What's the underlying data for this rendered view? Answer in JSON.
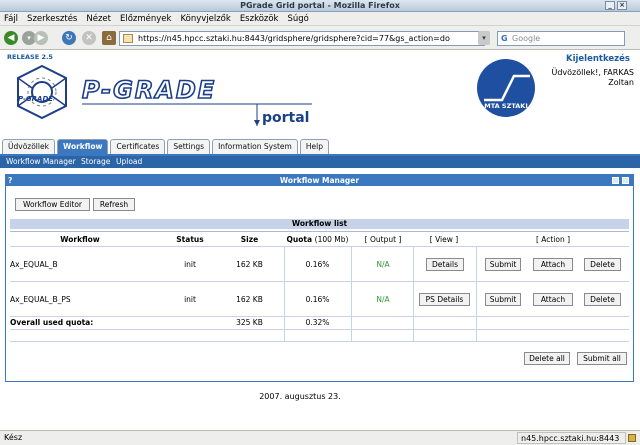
{
  "window": {
    "title": "PGrade Grid portal - Mozilla Firefox"
  },
  "menu": [
    "Fájl",
    "Szerkesztés",
    "Nézet",
    "Előzmények",
    "Könyvjelzők",
    "Eszközök",
    "Súgó"
  ],
  "nav": {
    "url": "https://n45.hpcc.sztaki.hu:8443/gridsphere/gridsphere?cid=77&gs_action=do",
    "search_placeholder": "Google"
  },
  "header": {
    "release": "RELEASE 2.5",
    "logo_small": "P-GRADE",
    "logo_big": "P-GRADE",
    "logo_portal": "portal",
    "mta_label": "MTA SZTAKI",
    "login_link": "Kijelentkezés",
    "welcome_line1": "Üdvözöllek!, FARKAS",
    "welcome_line2": "Zoltan"
  },
  "tabs": [
    {
      "label": "Üdvözöllek",
      "active": false
    },
    {
      "label": "Workflow",
      "active": true
    },
    {
      "label": "Certificates",
      "active": false
    },
    {
      "label": "Settings",
      "active": false
    },
    {
      "label": "Information System",
      "active": false
    },
    {
      "label": "Help",
      "active": false
    }
  ],
  "subnav": [
    "Workflow Manager",
    "Storage",
    "Upload"
  ],
  "portlet": {
    "title": "Workflow Manager",
    "help_icon": "?",
    "buttons": {
      "editor": "Workflow Editor",
      "refresh": "Refresh"
    },
    "list_title": "Workflow list",
    "columns": {
      "workflow": "Workflow",
      "status": "Status",
      "size": "Size",
      "quota": "Quota",
      "quota_unit": "(100 Mb)",
      "output": "[ Output ]",
      "view": "[ View ]",
      "action": "[ Action ]"
    },
    "rows": [
      {
        "name": "Ax_EQUAL_B",
        "status": "init",
        "size": "162 KB",
        "quota": "0.16%",
        "output": "N/A",
        "view": "Details",
        "submit": "Submit",
        "attach": "Attach",
        "delete": "Delete"
      },
      {
        "name": "Ax_EQUAL_B_PS",
        "status": "init",
        "size": "162 KB",
        "quota": "0.16%",
        "output": "N/A",
        "view": "PS Details",
        "submit": "Submit",
        "attach": "Attach",
        "delete": "Delete"
      }
    ],
    "overall": {
      "label": "Overall used quota:",
      "size": "325 KB",
      "quota": "0.32%"
    },
    "bottom_buttons": {
      "delete_all": "Delete all",
      "submit_all": "Submit all"
    }
  },
  "footer": {
    "date": "2007. augusztus 23."
  },
  "status": {
    "left": "Kész",
    "right": "n45.hpcc.sztaki.hu:8443"
  }
}
